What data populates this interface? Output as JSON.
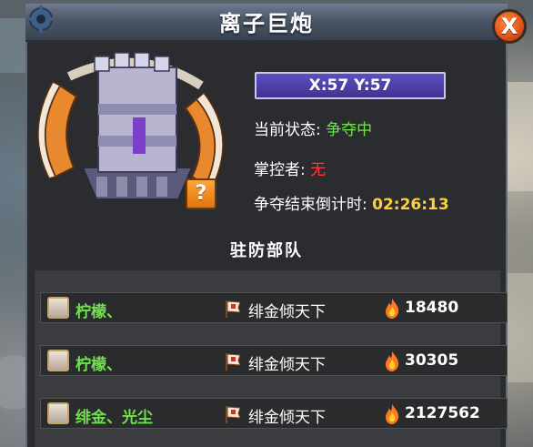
{
  "window": {
    "title": "离子巨炮"
  },
  "coordinates": {
    "text": "X:57  Y:57"
  },
  "info": {
    "status_label": "当前状态:",
    "status_value": "争夺中",
    "owner_label": "掌控者:",
    "owner_value": "无",
    "countdown_label": "争夺结束倒计时:",
    "countdown_value": "02:26:13"
  },
  "help": {
    "label": "?"
  },
  "close": {
    "label": "X"
  },
  "garrison": {
    "title": "驻防部队",
    "rows": [
      {
        "player": "柠檬、",
        "guild": "绯金倾天下",
        "power": "18480"
      },
      {
        "player": "柠檬、",
        "guild": "绯金倾天下",
        "power": "30305"
      },
      {
        "player": "绯金、光尘",
        "guild": "绯金倾天下",
        "power": "2127562"
      }
    ]
  },
  "colors": {
    "status_green": "#6fe34b",
    "owner_red": "#ff3b3b",
    "countdown_yellow": "#ffcf3a",
    "close_orange": "#e2561b",
    "coord_purple": "#4a3cab"
  }
}
